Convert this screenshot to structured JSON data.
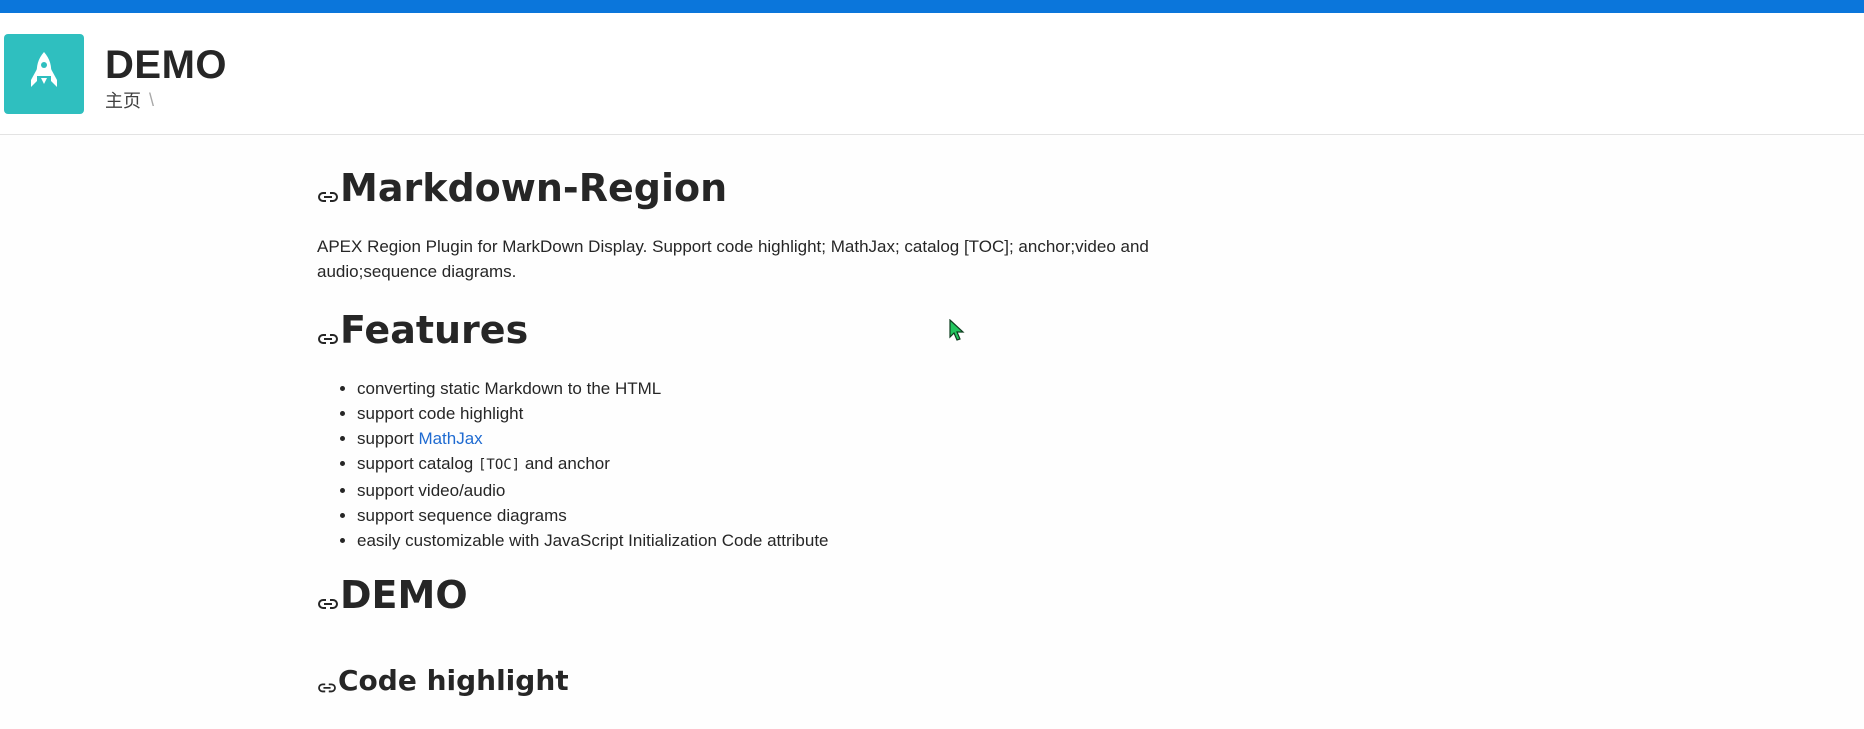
{
  "header": {
    "app_title": "DEMO",
    "breadcrumb": {
      "home": "主页",
      "separator": "\\"
    },
    "logo_icon": "rocket-icon",
    "logo_color": "#2fbfbf",
    "top_bar_color": "#0b76db"
  },
  "content": {
    "h1_title": "Markdown-Region",
    "description": "APEX Region Plugin for MarkDown Display. Support code highlight; MathJax; catalog [TOC]; anchor;video and audio;sequence diagrams.",
    "features_heading": "Features",
    "features": {
      "item1": "converting static Markdown to the HTML",
      "item2": "support code highlight",
      "item3_prefix": "support ",
      "item3_link": "MathJax",
      "item4_prefix": "support catalog ",
      "item4_code": "[TOC]",
      "item4_suffix": " and anchor",
      "item5": "support video/audio",
      "item6": "support sequence diagrams",
      "item7": "easily customizable with JavaScript Initialization Code attribute"
    },
    "demo_heading": "DEMO",
    "code_highlight_heading": "Code highlight",
    "link_color": "#1f6bd1",
    "anchor_icon": "link-icon"
  }
}
